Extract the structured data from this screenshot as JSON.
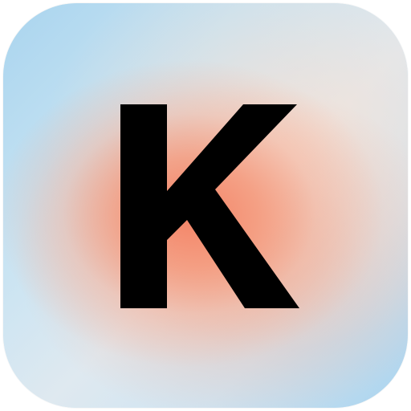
{
  "app_icon": {
    "letter": "K",
    "glyph_color": "#000000",
    "colors": {
      "background_blue": "#bfe0f2",
      "glow_orange": "#f48062",
      "glow_peach": "#f6b29b"
    }
  }
}
